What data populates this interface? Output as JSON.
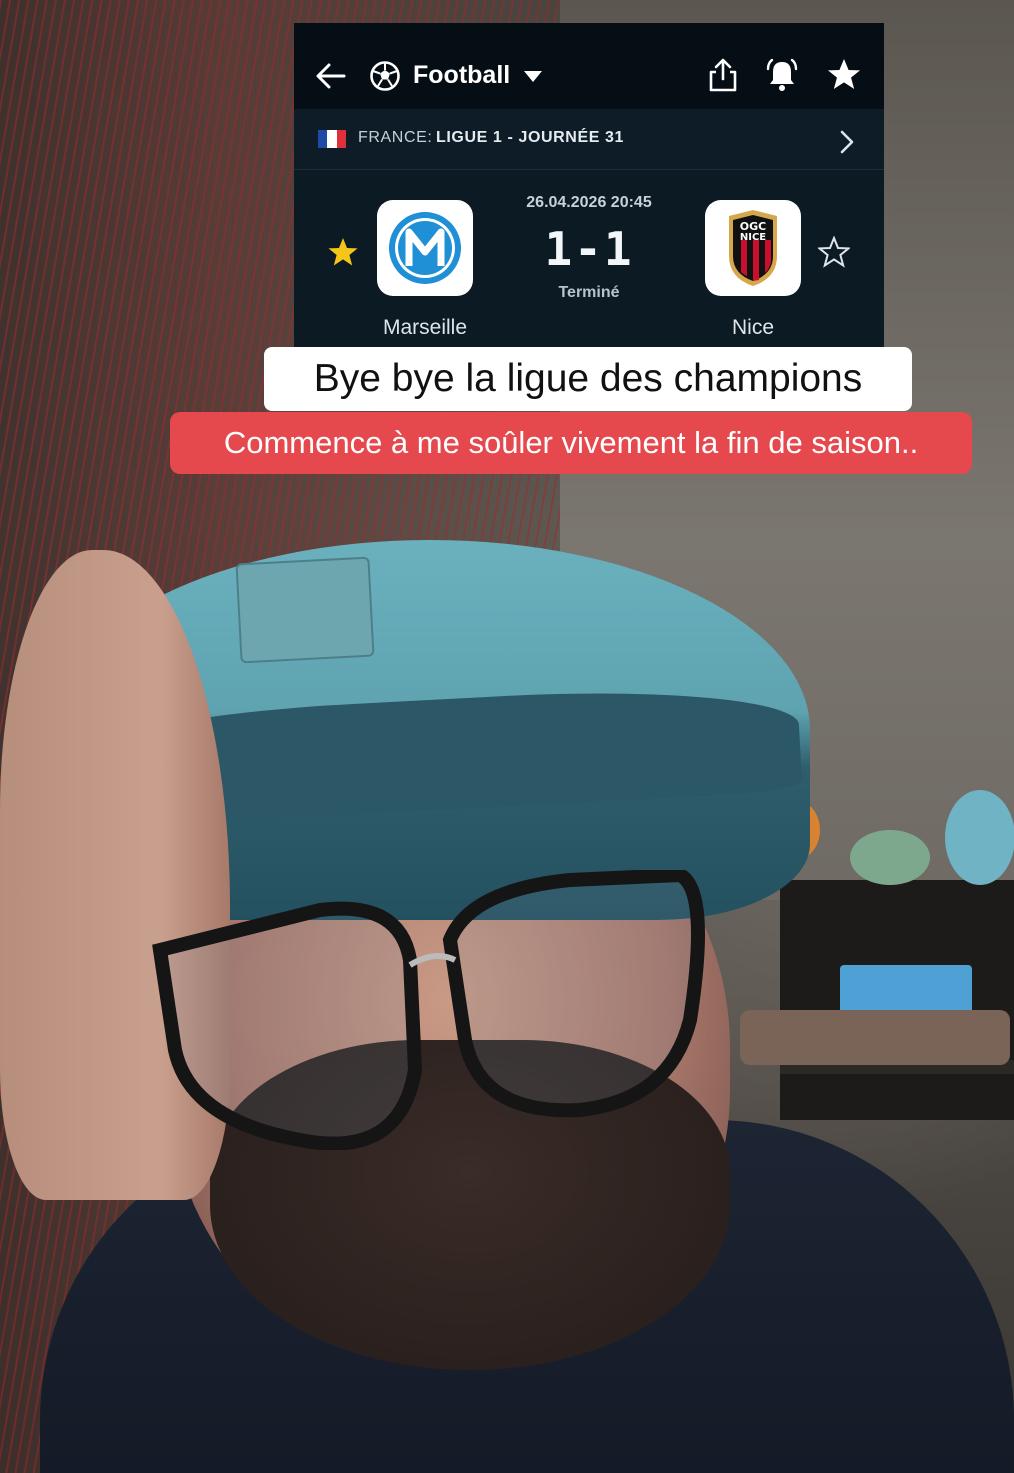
{
  "app": {
    "header": {
      "sport_title": "Football",
      "icons": [
        "back-arrow-icon",
        "soccer-ball-icon",
        "dropdown-caret-icon",
        "share-icon",
        "bell-icon",
        "star-icon"
      ]
    },
    "league": {
      "country": "FRANCE:",
      "name": "LIGUE 1 - JOURNÉE 31",
      "flag_colors": [
        "#1f4aa8",
        "#ffffff",
        "#e0313a"
      ]
    },
    "match": {
      "datetime": "26.04.2026 20:45",
      "score": "1-1",
      "status": "Terminé",
      "home": {
        "name": "Marseille",
        "favorited": true,
        "crest_color": "#1f8fd6"
      },
      "away": {
        "name": "Nice",
        "favorited": false,
        "crest_colors": [
          "#c8102e",
          "#111111",
          "#d4a84b"
        ],
        "crest_text": "OGC NICE"
      }
    }
  },
  "captions": {
    "line1": "Bye bye la ligue des champions",
    "line2": "Commence à me soûler vivement la fin de saison.."
  },
  "colors": {
    "caption2_bg": "#e5484d",
    "app_bg": "#0c1a24",
    "fav_star": "#f5c518"
  }
}
